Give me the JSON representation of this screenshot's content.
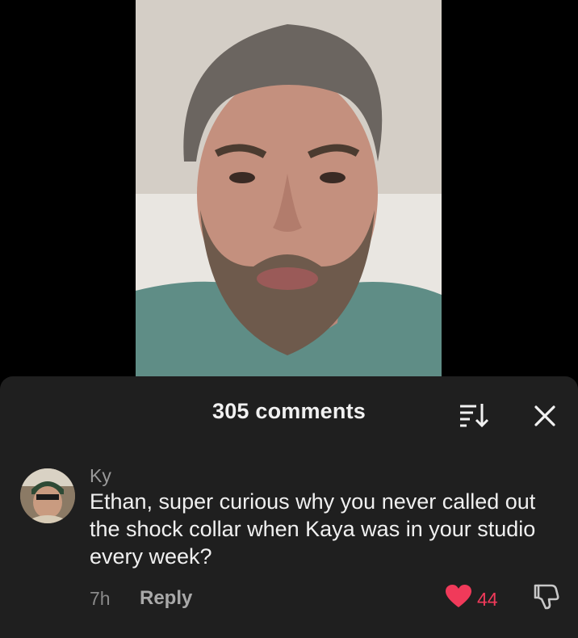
{
  "video": {
    "icon": "person-video-frame"
  },
  "comments_sheet": {
    "title": "305 comments",
    "sort_icon": "sort-icon",
    "close_icon": "close-icon"
  },
  "comment": {
    "username": "Ky",
    "text": "Ethan, super curious why you never called out the shock collar when Kaya was in your studio every week?",
    "timestamp": "7h",
    "reply_label": "Reply",
    "like_count": "44",
    "liked": true,
    "colors": {
      "like": "#f03a5a"
    }
  }
}
